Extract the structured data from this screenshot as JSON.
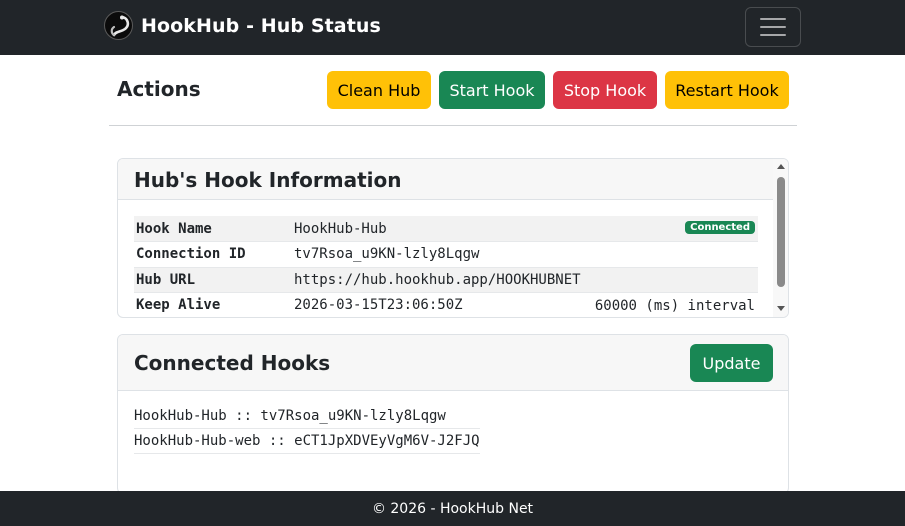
{
  "navbar": {
    "brand_title": "HookHub - Hub Status",
    "logo_icon": "hook-logo-icon",
    "toggle_icon": "hamburger-menu-icon",
    "bg_color": "#212529"
  },
  "actions": {
    "title": "Actions",
    "clean_hub_label": "Clean Hub",
    "start_hook_label": "Start Hook",
    "stop_hook_label": "Stop Hook",
    "restart_hook_label": "Restart Hook"
  },
  "hub_info": {
    "title": "Hub's Hook Information",
    "rows": [
      {
        "key": "Hook Name",
        "value": "HookHub-Hub",
        "badge": "Connected"
      },
      {
        "key": "Connection ID",
        "value": "tv7Rsoa_u9KN-lzly8Lqgw"
      },
      {
        "key": "Hub URL",
        "value": "https://hub.hookhub.app/HOOKHUBNET"
      },
      {
        "key": "Keep Alive",
        "value": "2026-03-15T23:06:50Z",
        "extra": "60000 (ms) interval"
      }
    ]
  },
  "connected_hooks": {
    "title": "Connected Hooks",
    "update_label": "Update",
    "items": [
      "HookHub-Hub :: tv7Rsoa_u9KN-lzly8Lqgw",
      "HookHub-Hub-web :: eCT1JpXDVEyVgM6V-J2FJQ"
    ]
  },
  "footer": {
    "text": "© 2026 - HookHub Net"
  },
  "colors": {
    "warning": "#ffc107",
    "success": "#198754",
    "danger": "#dc3545",
    "dark": "#212529"
  }
}
